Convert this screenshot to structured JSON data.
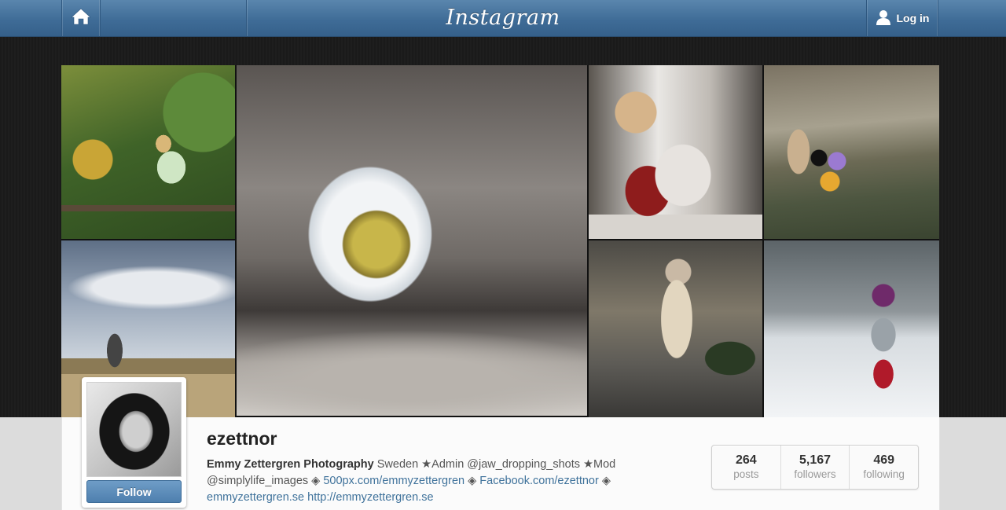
{
  "header": {
    "logo": "Instagram",
    "home_icon": "home-icon",
    "login_icon": "user-icon",
    "login_label": "Log in",
    "background_color": "#4a76a0"
  },
  "photos": [
    {
      "id": 1,
      "alt": "girl-on-bench"
    },
    {
      "id": 2,
      "alt": "frosted-daisy"
    },
    {
      "id": 3,
      "alt": "boy-with-toy"
    },
    {
      "id": 4,
      "alt": "child-with-balloons"
    },
    {
      "id": 5,
      "alt": "child-on-dune"
    },
    {
      "id": 6,
      "alt": "girl-in-coat"
    },
    {
      "id": 7,
      "alt": "toddler-in-snow"
    }
  ],
  "profile": {
    "username": "ezettnor",
    "follow_label": "Follow",
    "bio": {
      "name": "Emmy Zettergren Photography",
      "text1": " Sweden ★Admin @jaw_dropping_shots ★Mod @simplylife_images ◈ ",
      "link1": "500px.com/emmyzettergren",
      "sep1": " ◈ ",
      "link2": "Facebook.com/ezettnor",
      "sep2": " ◈ ",
      "link3": "emmyzettergren.se",
      "sep3": " ",
      "link4": "http://emmyzettergren.se"
    },
    "stats": [
      {
        "count": "264",
        "label": "posts"
      },
      {
        "count": "5,167",
        "label": "followers"
      },
      {
        "count": "469",
        "label": "following"
      }
    ],
    "accent_color": "#3f729b"
  }
}
